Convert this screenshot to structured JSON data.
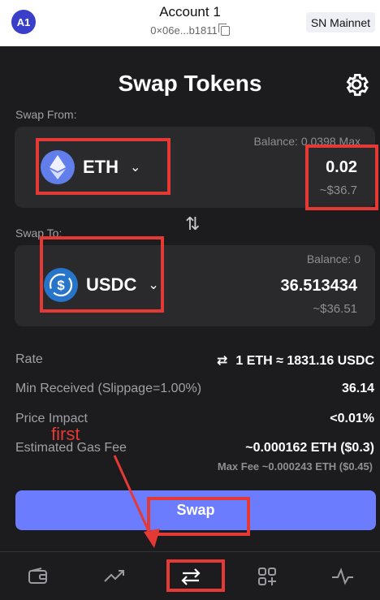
{
  "header": {
    "avatar": "A1",
    "account_name": "Account 1",
    "address": "0×06e...b1811",
    "network": "SN Mainnet"
  },
  "swap": {
    "title": "Swap Tokens",
    "from_label": "Swap From:",
    "to_label": "Swap To:",
    "from": {
      "token": "ETH",
      "balance": "Balance: 0.0398",
      "balance_max": "Max",
      "amount": "0.02",
      "usd": "~$36.7"
    },
    "to": {
      "token": "USDC",
      "balance": "Balance: 0",
      "amount": "36.513434",
      "usd": "~$36.51"
    },
    "swap_direction_icon": "swap-vertical-arrows"
  },
  "details": {
    "rate_label": "Rate",
    "rate_value": "1 ETH ≈ 1831.16 USDC",
    "min_received_label": "Min Received (Slippage=1.00%)",
    "min_received_value": "36.14",
    "price_impact_label": "Price Impact",
    "price_impact_value": "<0.01%",
    "gas_fee_label": "Estimated Gas Fee",
    "gas_fee_value": "~0.000162 ETH ($0.3)",
    "max_fee": "Max Fee ~0.000243 ETH ($0.45)"
  },
  "swap_button": "Swap",
  "annotation": {
    "text": "first",
    "color": "#e53935"
  },
  "nav": {
    "items": [
      "wallet-icon",
      "trending-icon",
      "swap-icon",
      "apps-icon",
      "activity-icon"
    ],
    "active": "swap-icon"
  },
  "colors": {
    "background": "#1c1c1e",
    "card": "#2a2a2d",
    "accent": "#6b7cff",
    "eth": "#627eea",
    "usdc": "#2775ca"
  }
}
